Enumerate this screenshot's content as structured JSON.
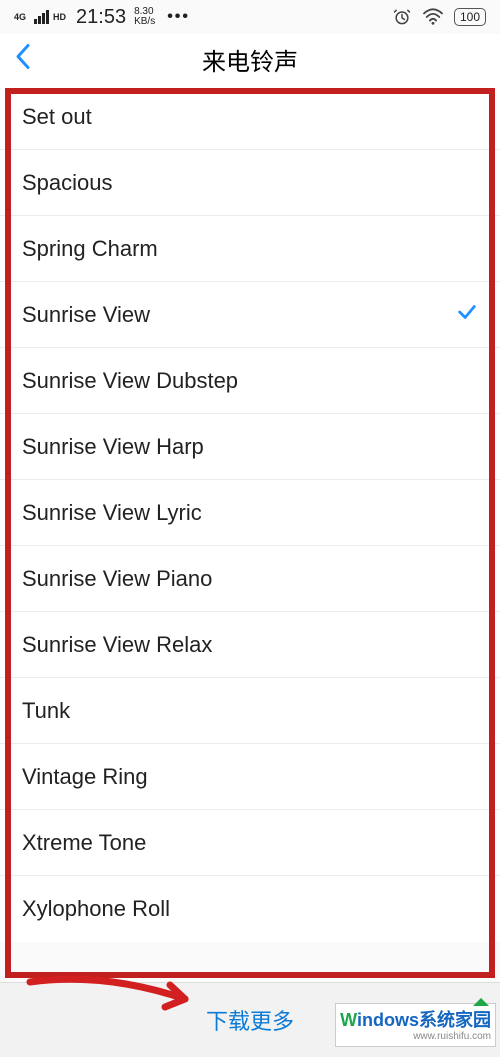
{
  "status": {
    "net_label_top": "4G",
    "net_label_bottom": "HD",
    "time": "21:53",
    "speed_top": "8.30",
    "speed_bottom": "KB/s",
    "dots": "•••",
    "battery": "100"
  },
  "nav": {
    "title": "来电铃声"
  },
  "ringtones": [
    {
      "name": "Set out",
      "selected": false
    },
    {
      "name": "Spacious",
      "selected": false
    },
    {
      "name": "Spring Charm",
      "selected": false
    },
    {
      "name": "Sunrise View",
      "selected": true
    },
    {
      "name": "Sunrise View Dubstep",
      "selected": false
    },
    {
      "name": "Sunrise View Harp",
      "selected": false
    },
    {
      "name": "Sunrise View Lyric",
      "selected": false
    },
    {
      "name": "Sunrise View Piano",
      "selected": false
    },
    {
      "name": "Sunrise View Relax",
      "selected": false
    },
    {
      "name": "Tunk",
      "selected": false
    },
    {
      "name": "Vintage Ring",
      "selected": false
    },
    {
      "name": "Xtreme Tone",
      "selected": false
    },
    {
      "name": "Xylophone Roll",
      "selected": false
    }
  ],
  "bottom": {
    "download_more": "下载更多"
  },
  "watermark": {
    "brand_w": "W",
    "brand_rest": "indows系统家园",
    "sub": "www.ruishifu.com"
  }
}
